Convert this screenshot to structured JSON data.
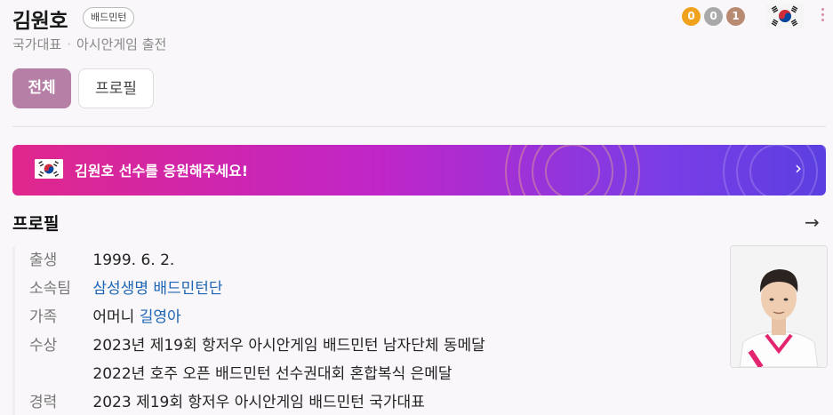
{
  "header": {
    "name": "김원호",
    "sport_badge": "배드민턴",
    "subtitle_left": "국가대표",
    "subtitle_right": "아시안게임 출전",
    "medals": {
      "gold": "0",
      "silver": "0",
      "bronze": "1"
    },
    "flag_icon": "south-korea-flag-icon"
  },
  "tabs": [
    {
      "label": "전체",
      "selected": true
    },
    {
      "label": "프로필",
      "selected": false
    }
  ],
  "banner": {
    "text": "김원호 선수를 응원해주세요!",
    "colors": {
      "start": "#e0278c",
      "mid": "#c026c8",
      "end": "#5b3fe0"
    }
  },
  "profile": {
    "title": "프로필",
    "rows": [
      {
        "label": "출생",
        "value": "1999. 6. 2."
      },
      {
        "label": "소속팀",
        "value": "삼성생명 배드민턴단"
      },
      {
        "label": "가족",
        "value_prefix": "어머니",
        "value_link": "길영아"
      },
      {
        "label": "수상",
        "value": "2023년 제19회 항저우 아시안게임 배드민턴 남자단체 동메달",
        "value2": "2022년 호주 오픈 배드민턴 선수권대회 혼합복식 은메달"
      },
      {
        "label": "경력",
        "value": "2023 제19회 항저우 아시안게임 배드민턴 국가대표"
      }
    ]
  }
}
